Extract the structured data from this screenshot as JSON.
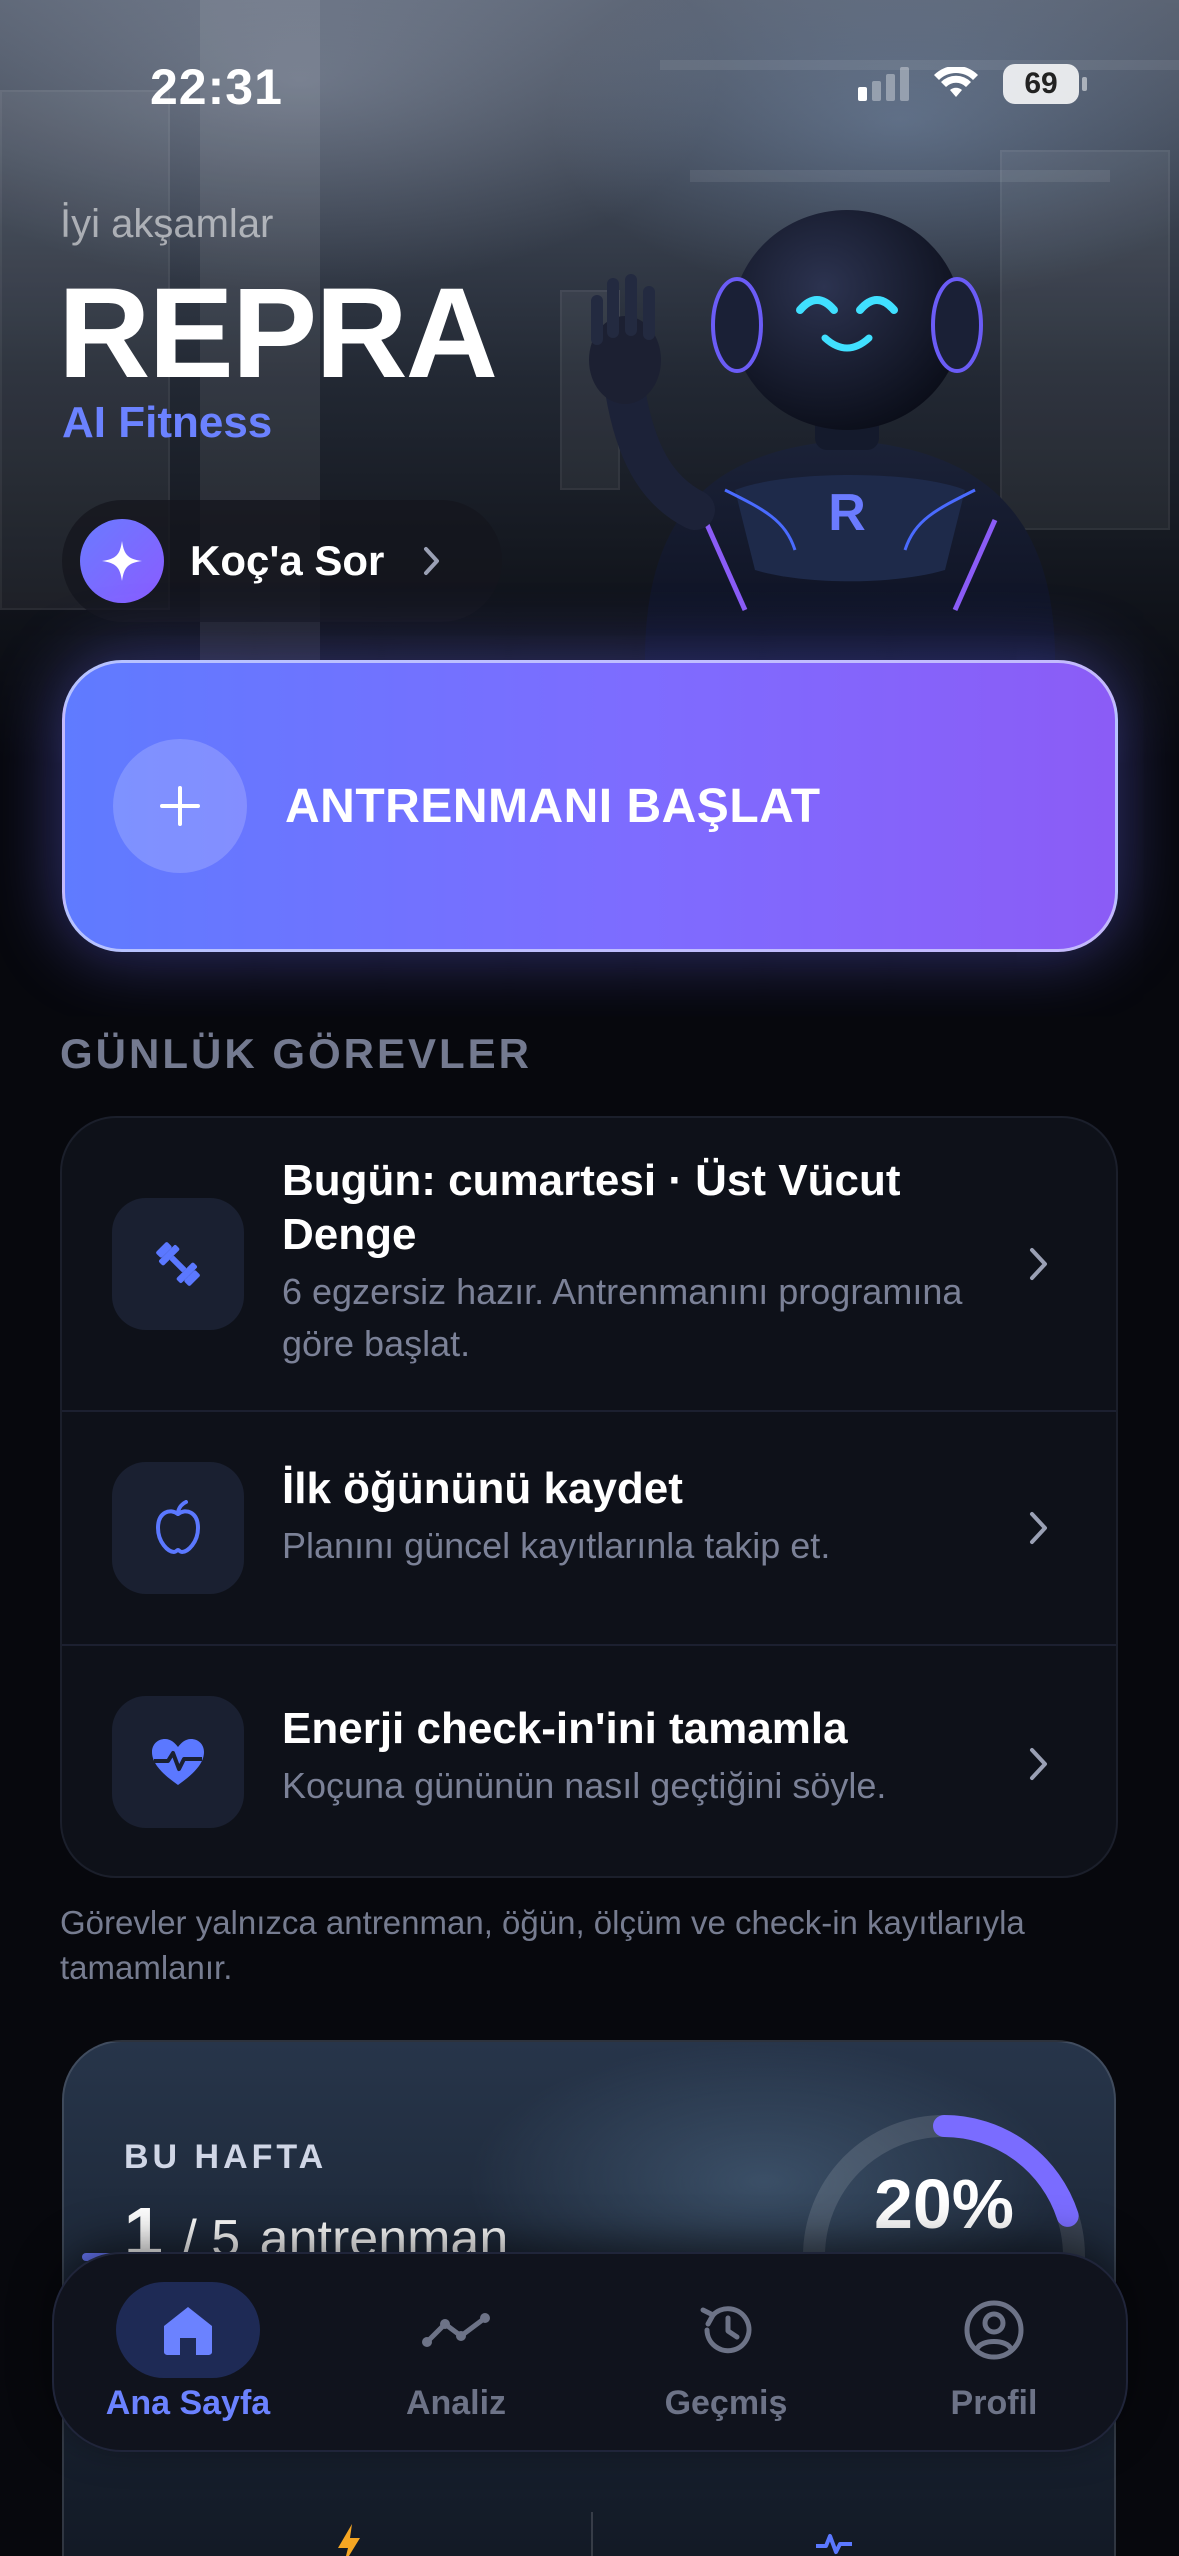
{
  "status_bar": {
    "time": "22:31",
    "battery": "69"
  },
  "header": {
    "greeting": "İyi akşamlar",
    "brand": "REPRA",
    "subtitle": "AI Fitness"
  },
  "ask_coach": {
    "label": "Koç'a Sor",
    "icon": "sparkle-icon"
  },
  "start_workout": {
    "label": "ANTRENMANI BAŞLAT",
    "icon": "plus-icon"
  },
  "daily_tasks": {
    "title": "GÜNLÜK GÖREVLER",
    "items": [
      {
        "title": "Bugün: cumartesi · Üst Vücut Denge",
        "subtitle": "6 egzersiz hazır. Antrenmanını programına göre başlat.",
        "icon": "dumbbell-icon"
      },
      {
        "title": "İlk öğününü kaydet",
        "subtitle": "Planını güncel kayıtlarınla takip et.",
        "icon": "apple-icon"
      },
      {
        "title": "Enerji check-in'ini tamamla",
        "subtitle": "Koçuna gününün nasıl geçtiğini söyle.",
        "icon": "heart-pulse-icon"
      }
    ],
    "note": "Görevler yalnızca antrenman, öğün, ölçüm ve check-in kayıtlarıyla tamamlanır."
  },
  "weekly": {
    "label": "BU HAFTA",
    "done": "1",
    "total": "/ 5",
    "unit": "antrenman",
    "progress_fraction": 0.2,
    "progress_label": "20%"
  },
  "tabs": [
    {
      "label": "Ana Sayfa",
      "icon": "home-icon",
      "active": true
    },
    {
      "label": "Analiz",
      "icon": "trend-line-icon",
      "active": false
    },
    {
      "label": "Geçmiş",
      "icon": "history-icon",
      "active": false
    },
    {
      "label": "Profil",
      "icon": "user-circle-icon",
      "active": false
    }
  ],
  "colors": {
    "accent": "#6b82ff",
    "button_gradient_start": "#5f7bff",
    "button_gradient_end": "#8b5cf6",
    "background": "#07080d",
    "card": "#0e1119"
  }
}
